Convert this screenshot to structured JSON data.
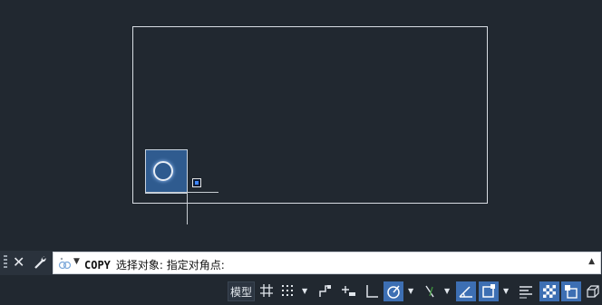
{
  "command_line": {
    "command": "COPY",
    "prompt": "选择对象: 指定对角点:"
  },
  "status_bar": {
    "model_label": "模型"
  },
  "colors": {
    "background": "#212830",
    "selection_fill": "#2f5b8f",
    "active_toggle": "#3d6fb3"
  }
}
